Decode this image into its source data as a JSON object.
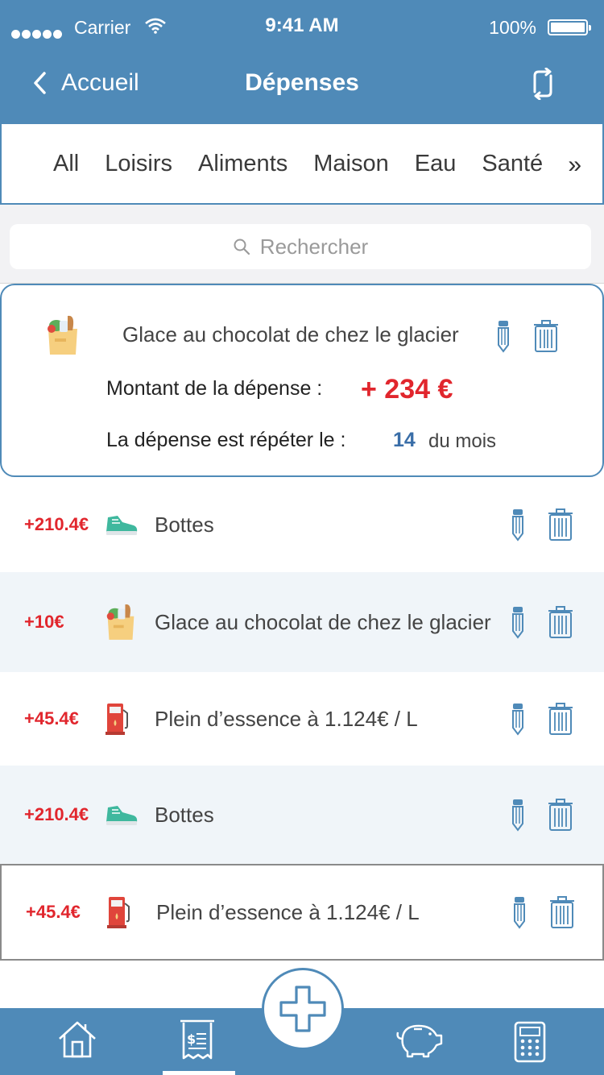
{
  "status_bar": {
    "carrier": "Carrier",
    "time": "9:41 AM",
    "battery": "100%"
  },
  "nav": {
    "back_label": "Accueil",
    "title": "Dépenses"
  },
  "categories": {
    "items": [
      "All",
      "Loisirs",
      "Aliments",
      "Maison",
      "Eau",
      "Santé"
    ],
    "more": "»"
  },
  "search": {
    "placeholder": "Rechercher"
  },
  "detail": {
    "title": "Glace au chocolat de chez le glacier",
    "amount_label": "Montant de la dépense :",
    "amount": "+ 234 €",
    "repeat_label": "La dépense est répéter le  :",
    "repeat_day": "14",
    "repeat_suffix": "du mois",
    "icon": "grocery-bag-icon"
  },
  "expenses": [
    {
      "amount": "+210.4€",
      "label": "Bottes",
      "icon": "sneaker-icon"
    },
    {
      "amount": "+10€",
      "label": "Glace au chocolat de chez le glacier",
      "icon": "grocery-bag-icon"
    },
    {
      "amount": "+45.4€",
      "label": "Plein d’essence à 1.124€ / L",
      "icon": "fuel-pump-icon"
    },
    {
      "amount": "+210.4€",
      "label": "Bottes",
      "icon": "sneaker-icon"
    },
    {
      "amount": "+45.4€",
      "label": "Plein d’essence à 1.124€ / L",
      "icon": "fuel-pump-icon"
    }
  ],
  "tabbar": {
    "items": [
      "home-icon",
      "receipt-icon",
      "piggy-bank-icon",
      "calculator-icon"
    ],
    "selected": "receipt-icon",
    "fab": "add-icon"
  },
  "colors": {
    "primary": "#4f8ab8",
    "amount": "#e1262d",
    "accent_blue": "#3a6ea8",
    "row_alt": "#f0f5f9"
  }
}
